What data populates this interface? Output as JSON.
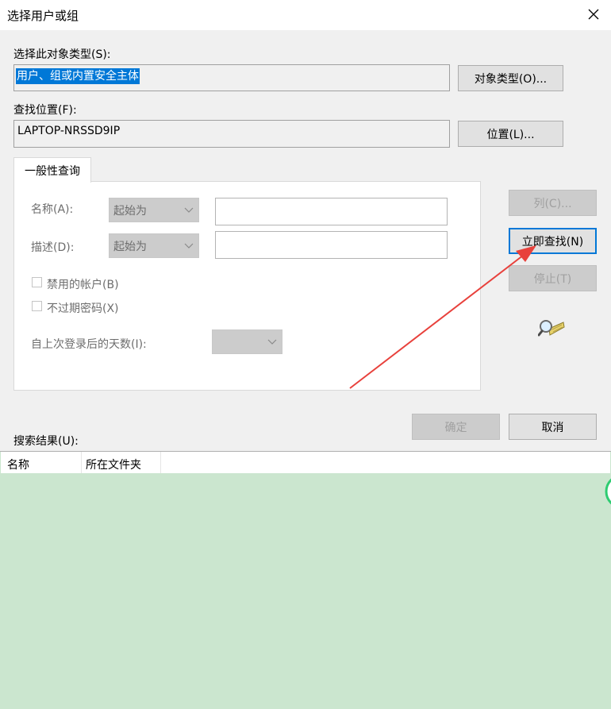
{
  "window": {
    "title": "选择用户或组"
  },
  "object_type": {
    "label": "选择此对象类型(S):",
    "value": "用户、组或内置安全主体",
    "button": "对象类型(O)..."
  },
  "location": {
    "label": "查找位置(F):",
    "value": "LAPTOP-NRSSD9IP",
    "button": "位置(L)..."
  },
  "tab": {
    "label": "一般性查询"
  },
  "query": {
    "name_label": "名称(A):",
    "name_mode": "起始为",
    "desc_label": "描述(D):",
    "desc_mode": "起始为",
    "disabled_accounts": "禁用的帐户(B)",
    "non_expiring_pw": "不过期密码(X)",
    "days_since_logon": "自上次登录后的天数(I):"
  },
  "side_buttons": {
    "columns": "列(C)...",
    "find_now": "立即查找(N)",
    "stop": "停止(T)"
  },
  "footer_buttons": {
    "ok": "确定",
    "cancel": "取消"
  },
  "results": {
    "label": "搜索结果(U):",
    "columns": [
      "名称",
      "所在文件夹"
    ]
  },
  "colors": {
    "accent": "#0078d7",
    "annotation_arrow": "#e8413c",
    "results_bg": "#cbe6cf"
  }
}
